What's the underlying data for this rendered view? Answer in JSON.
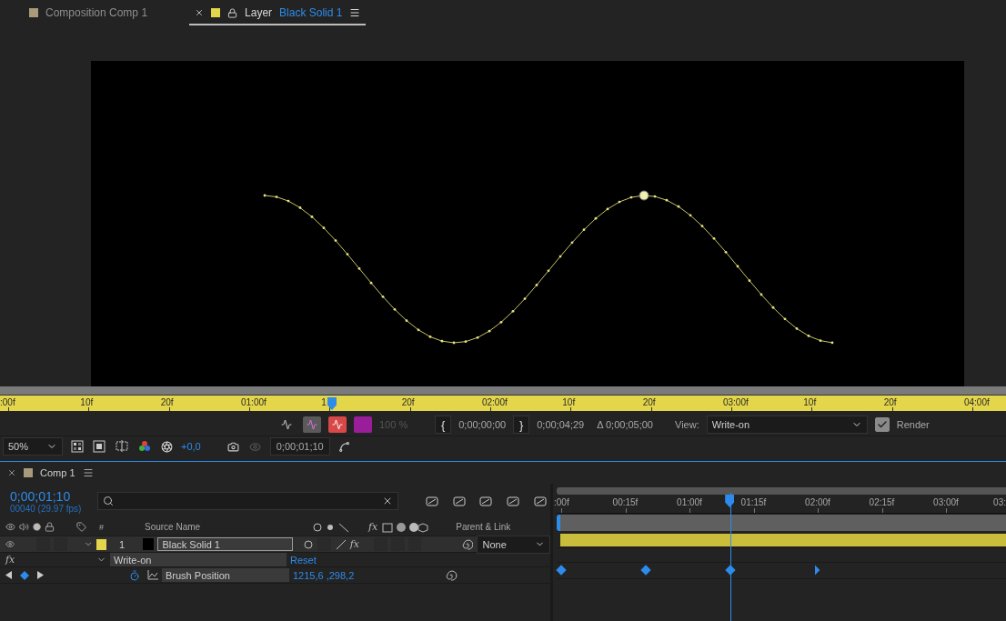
{
  "tabs": [
    {
      "kind": "composition",
      "label": "Composition Comp 1",
      "color": "#a89a7a",
      "selected": false
    },
    {
      "kind": "layer",
      "label": "Layer",
      "layer_name": "Black Solid 1",
      "color": "#e3d64a",
      "selected": true
    }
  ],
  "layer_ruler": {
    "labels": [
      ":00f",
      "10f",
      "20f",
      "01:00f",
      "1",
      "20f",
      "02:00f",
      "10f",
      "20f",
      "03:00f",
      "10f",
      "20f",
      "04:00f"
    ],
    "level": 0.33
  },
  "layer_controls": {
    "opacity": "100 %",
    "in_button": "{",
    "out_button": "}",
    "in_point": "0;00;00;00",
    "out_point": "0;00;04;29",
    "duration": "Δ 0;00;05;00",
    "view_label": "View:",
    "view": "Write-on",
    "render": {
      "label": "Render",
      "checked": true
    }
  },
  "viewer_toolbar": {
    "zoom": "50%",
    "exposure": "+0,0",
    "timecode": "0;00;01;10"
  },
  "timeline": {
    "tab": "Comp 1",
    "timecode": "0;00;01;10",
    "frame_info": "00040 (29.97 fps)",
    "columns": {
      "number": "#",
      "source_name": "Source Name",
      "switch_fx": "fx",
      "parent": "Parent & Link"
    },
    "ruler": {
      "labels": [
        ":00f",
        "00:15f",
        "01:00f",
        "01:15f",
        "02:00f",
        "02:15f",
        "03:00f",
        "03:"
      ],
      "level": 0.387
    },
    "layers": [
      {
        "number": "1",
        "name": "Black Solid 1",
        "color": "#e3d64a",
        "expanded": true,
        "fx": "fx",
        "effects_on": true,
        "parent": "None",
        "effects": [
          {
            "label": "fx",
            "name": "Write-on",
            "expanded": true,
            "reset": "Reset",
            "properties": [
              {
                "name": "Brush Position",
                "value": "1215,6 ,298,2",
                "keyframes": [
                  {
                    "kind": "full",
                    "level": 0.01
                  },
                  {
                    "kind": "full",
                    "level": 0.198
                  },
                  {
                    "kind": "full",
                    "level": 0.387
                  },
                  {
                    "kind": "half",
                    "level": 0.575
                  }
                ]
              }
            ]
          }
        ]
      }
    ]
  }
}
